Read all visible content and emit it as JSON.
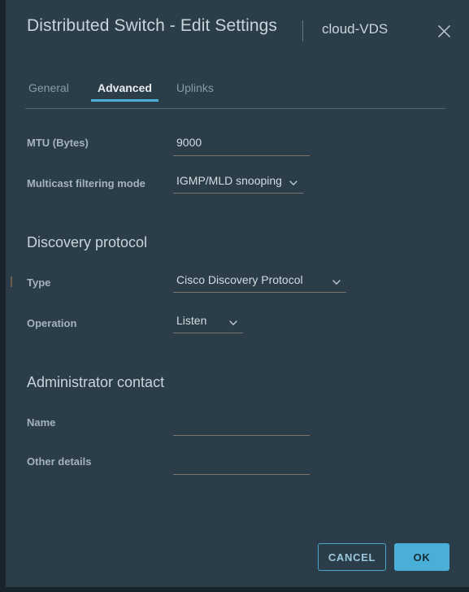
{
  "window": {
    "title": "Distributed Switch - Edit Settings",
    "subtitle": "cloud-VDS",
    "close_icon": "close-icon"
  },
  "tabs": [
    {
      "label": "General",
      "active": false
    },
    {
      "label": "Advanced",
      "active": true
    },
    {
      "label": "Uplinks",
      "active": false
    }
  ],
  "form": {
    "mtu": {
      "label": "MTU (Bytes)",
      "value": "9000",
      "placeholder": ""
    },
    "multicast": {
      "label": "Multicast filtering mode",
      "value": "IGMP/MLD snooping",
      "caret_icon": "chevron-down-icon"
    },
    "discovery_section": {
      "heading": "Discovery protocol",
      "type": {
        "label": "Type",
        "value": "Cisco Discovery Protocol",
        "caret_icon": "chevron-down-icon"
      },
      "operation": {
        "label": "Operation",
        "value": "Listen",
        "caret_icon": "chevron-down-icon"
      }
    },
    "admin_section": {
      "heading": "Administrator contact",
      "name": {
        "label": "Name",
        "value": "",
        "placeholder": ""
      },
      "other_details": {
        "label": "Other details",
        "value": "",
        "placeholder": ""
      }
    }
  },
  "footer": {
    "cancel_label": "CANCEL",
    "ok_label": "OK"
  },
  "colors": {
    "dialog_background": "#2a3d48",
    "page_background": "#17242b",
    "accent": "#49afd9",
    "label_text": "#a5b3bb",
    "value_text": "#d3dce0",
    "underline": "#7e766c",
    "primary_button_text": "#1b2a32"
  }
}
